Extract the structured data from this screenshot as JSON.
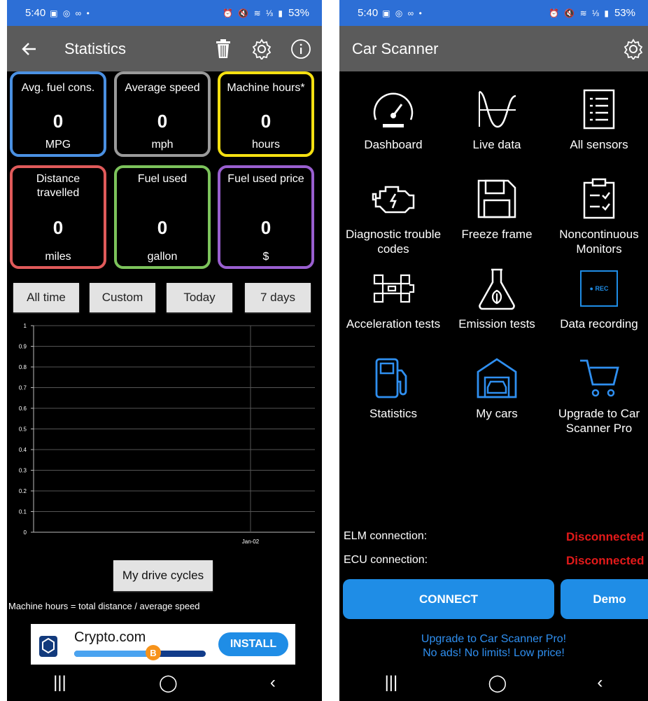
{
  "status_bar": {
    "time": "5:40",
    "icons_left": "▣ ◎ ∞ •",
    "icons_right": "⏰ 🔇 ≋ ⅓ ▮",
    "battery": "53%"
  },
  "statistics": {
    "title": "Statistics",
    "tiles": [
      {
        "title": "Avg. fuel cons.",
        "value": "0",
        "unit": "MPG",
        "color": "#4a90e2"
      },
      {
        "title": "Average speed",
        "value": "0",
        "unit": "mph",
        "color": "#9a9a9a"
      },
      {
        "title": "Machine hours*",
        "value": "0",
        "unit": "hours",
        "color": "#f5e011"
      },
      {
        "title": "Distance travelled",
        "value": "0",
        "unit": "miles",
        "color": "#e05a5a"
      },
      {
        "title": "Fuel used",
        "value": "0",
        "unit": "gallon",
        "color": "#7cc35b"
      },
      {
        "title": "Fuel used price",
        "value": "0",
        "unit": "$",
        "color": "#9a5fd0"
      }
    ],
    "ranges": [
      "All time",
      "Custom",
      "Today",
      "7 days"
    ],
    "drive_cycles_button": "My drive cycles",
    "note": "Machine hours = total distance / average speed",
    "ad": {
      "name": "Crypto.com",
      "install": "INSTALL",
      "coin": "B",
      "progress": 0.58
    }
  },
  "chart_data": {
    "type": "line",
    "y_ticks": [
      "1",
      "0.9",
      "0.8",
      "0.7",
      "0.6",
      "0.5",
      "0.4",
      "0.3",
      "0.2",
      "0.1",
      "0"
    ],
    "ylim": [
      0,
      1
    ],
    "x_ticks": [
      "Jan-02"
    ],
    "series": [],
    "grid": true
  },
  "car_scanner": {
    "title": "Car Scanner",
    "menu": [
      {
        "label": "Dashboard",
        "icon": "speedometer-icon"
      },
      {
        "label": "Live data",
        "icon": "wave-icon"
      },
      {
        "label": "All sensors",
        "icon": "list-icon"
      },
      {
        "label": "Diagnostic trouble codes",
        "icon": "engine-icon"
      },
      {
        "label": "Freeze frame",
        "icon": "floppy-icon"
      },
      {
        "label": "Noncontinuous Monitors",
        "icon": "clipboard-icon"
      },
      {
        "label": "Acceleration tests",
        "icon": "race-car-icon"
      },
      {
        "label": "Emission tests",
        "icon": "flask-icon"
      },
      {
        "label": "Data recording",
        "icon": "rec-icon"
      },
      {
        "label": "Statistics",
        "icon": "fuel-pump-icon"
      },
      {
        "label": "My cars",
        "icon": "garage-icon"
      },
      {
        "label": "Upgrade to Car Scanner Pro",
        "icon": "cart-icon"
      }
    ],
    "rec_label": "● REC",
    "elm_label": "ELM connection:",
    "elm_status": "Disconnected",
    "ecu_label": "ECU connection:",
    "ecu_status": "Disconnected",
    "connect": "CONNECT",
    "demo": "Demo",
    "promo_line1": "Upgrade to Car Scanner Pro!",
    "promo_line2": "No ads! No limits! Low price!"
  },
  "nav": {
    "recents": "|||",
    "home": "◯",
    "back": "‹"
  }
}
